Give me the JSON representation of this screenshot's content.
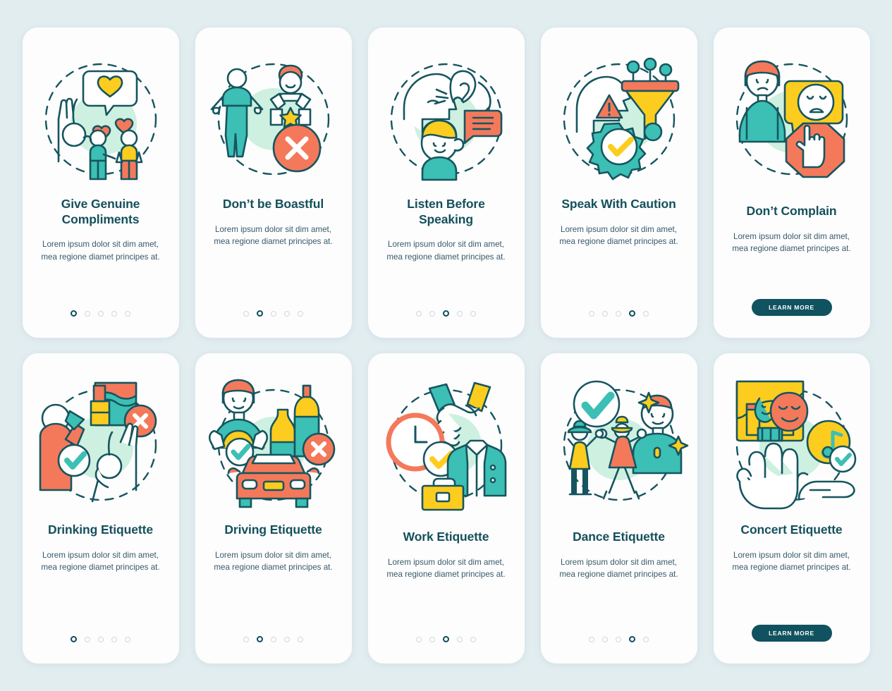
{
  "page": {
    "background_color": "#e2edf0",
    "card_background": "#fdfdfd",
    "title_color": "#14505c",
    "body_color": "#37596b",
    "accent_teal": "#3cbfb4",
    "accent_orange": "#f4795b",
    "accent_yellow": "#fccd1e",
    "accent_dark": "#10525f",
    "mint_blob": "#cdf0e0",
    "dot_inactive": "#cfd8dc",
    "dot_active": "#0d4d5c"
  },
  "shared": {
    "body_text": "Lorem ipsum dolor sit dim amet, mea regione diamet principes at.",
    "learn_more_label": "LEARN MORE",
    "dot_count": 5
  },
  "screens": [
    {
      "id": "give-genuine-compliments",
      "title": "Give Genuine Compliments",
      "body": "Lorem ipsum dolor sit dim amet, mea regione diamet principes at.",
      "active_dot": 1,
      "has_button": false,
      "illustration": "compliments-illustration"
    },
    {
      "id": "dont-be-boastful",
      "title": "Don’t be Boastful",
      "body": "Lorem ipsum dolor sit dim amet, mea regione diamet principes at.",
      "active_dot": 2,
      "has_button": false,
      "illustration": "boastful-illustration"
    },
    {
      "id": "listen-before-speaking",
      "title": "Listen Before Speaking",
      "body": "Lorem ipsum dolor sit dim amet, mea regione diamet principes at.",
      "active_dot": 3,
      "has_button": false,
      "illustration": "listening-illustration"
    },
    {
      "id": "speak-with-caution",
      "title": "Speak With Caution",
      "body": "Lorem ipsum dolor sit dim amet, mea regione diamet principes at.",
      "active_dot": 4,
      "has_button": false,
      "illustration": "caution-illustration"
    },
    {
      "id": "dont-complain",
      "title": "Don’t Complain",
      "body": "Lorem ipsum dolor sit dim amet, mea regione diamet principes at.",
      "active_dot": 0,
      "has_button": true,
      "button_label": "LEARN MORE",
      "illustration": "complain-illustration"
    },
    {
      "id": "drinking-etiquette",
      "title": "Drinking Etiquette",
      "body": "Lorem ipsum dolor sit dim amet, mea regione diamet principes at.",
      "active_dot": 1,
      "has_button": false,
      "illustration": "drinking-illustration"
    },
    {
      "id": "driving-etiquette",
      "title": "Driving Etiquette",
      "body": "Lorem ipsum dolor sit dim amet, mea regione diamet principes at.",
      "active_dot": 2,
      "has_button": false,
      "illustration": "driving-illustration"
    },
    {
      "id": "work-etiquette",
      "title": "Work Etiquette",
      "body": "Lorem ipsum dolor sit dim amet, mea regione diamet principes at.",
      "active_dot": 3,
      "has_button": false,
      "illustration": "work-illustration"
    },
    {
      "id": "dance-etiquette",
      "title": "Dance Etiquette",
      "body": "Lorem ipsum dolor sit dim amet, mea regione diamet principes at.",
      "active_dot": 4,
      "has_button": false,
      "illustration": "dance-illustration"
    },
    {
      "id": "concert-etiquette",
      "title": "Concert Etiquette",
      "body": "Lorem ipsum dolor sit dim amet, mea regione diamet principes at.",
      "active_dot": 0,
      "has_button": true,
      "button_label": "LEARN MORE",
      "illustration": "concert-illustration"
    }
  ]
}
